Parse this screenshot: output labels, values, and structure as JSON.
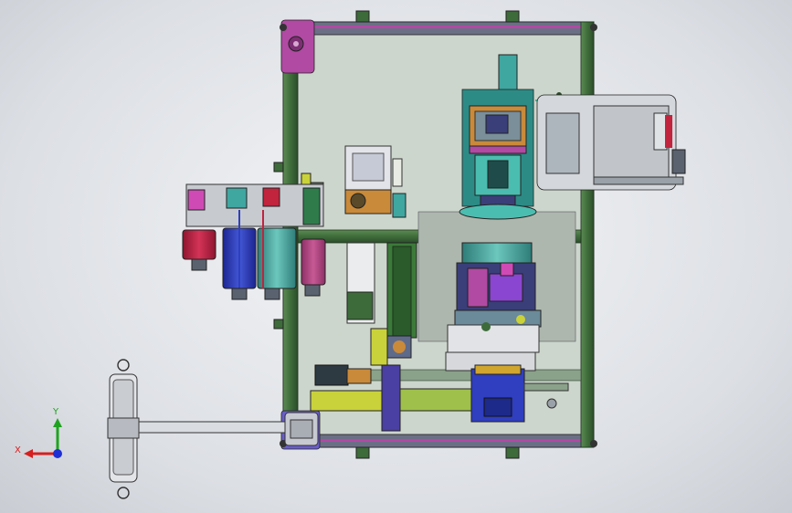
{
  "viewport": {
    "background": "#e4e6ea",
    "model": "cad-assembly-top-view"
  },
  "colors": {
    "frame_green": "#3d6b3a",
    "frame_dark": "#2b4a2a",
    "panel_fill": "#c9d3c8",
    "accent_magenta": "#b14aa3",
    "accent_purple": "#6a5ec7",
    "accent_teal": "#3fa6a0",
    "accent_red": "#c2233d",
    "accent_blue": "#2f3fbf",
    "accent_yellow": "#c9d23a",
    "accent_orange": "#c98a3a"
  },
  "triad": {
    "x_label": "X",
    "y_label": "Y",
    "x_color": "#d61f1f",
    "y_color": "#1fa31f",
    "z_color": "#1f2fd6"
  }
}
